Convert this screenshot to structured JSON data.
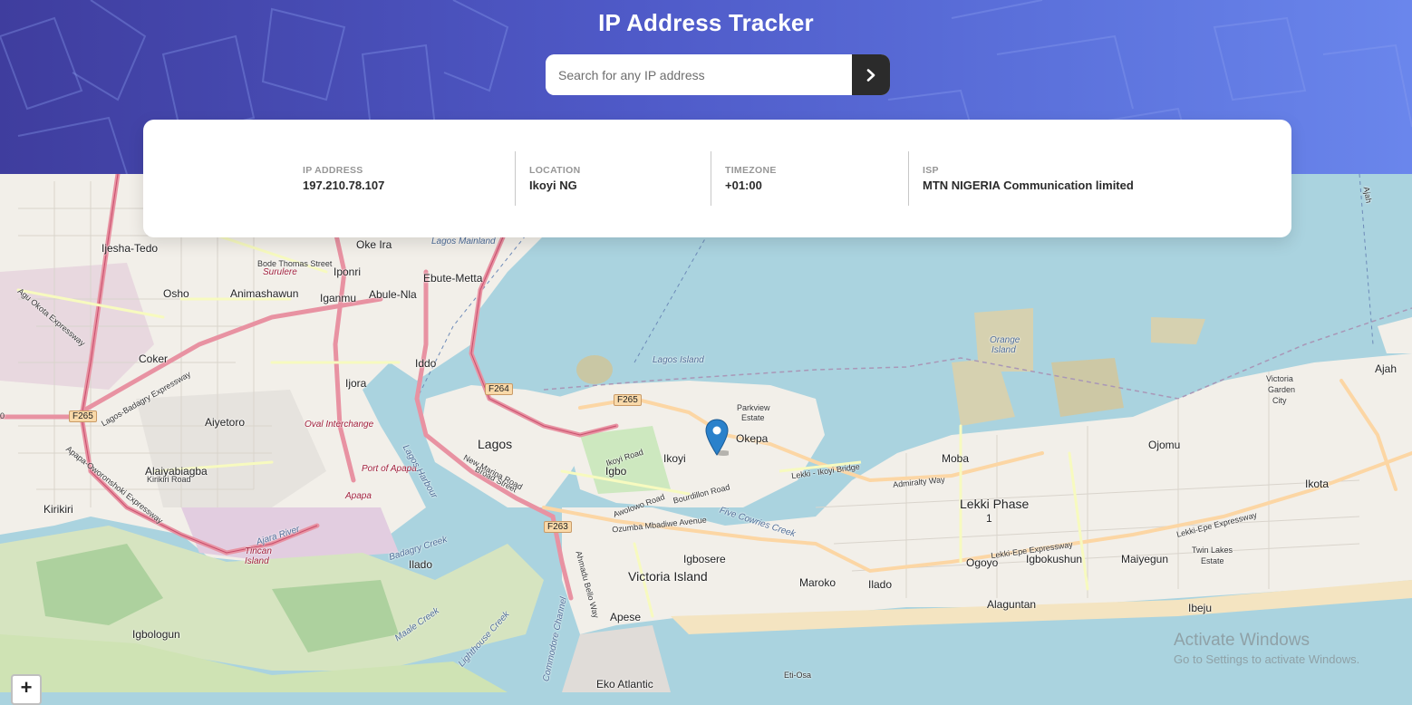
{
  "header": {
    "title": "IP Address Tracker",
    "gradient": [
      "#3f3d9e",
      "#6a86ec"
    ]
  },
  "search": {
    "placeholder": "Search for any IP address",
    "submit_icon": "chevron-right-icon"
  },
  "info": {
    "ip": {
      "label": "IP Address",
      "value": "197.210.78.107"
    },
    "location": {
      "label": "Location",
      "value": "Ikoyi NG"
    },
    "timezone": {
      "label": "Timezone",
      "value": "+01:00"
    },
    "isp": {
      "label": "ISP",
      "value": "MTN NIGERIA Communication limited"
    }
  },
  "map": {
    "marker_icon": "location-pin-icon",
    "zoom_in": "+",
    "colors": {
      "water": "#aad3df",
      "land": "#f2efe9",
      "marker": "#2a81cb"
    },
    "labels": {
      "ijesha_tedo": "Ijesha-Tedo",
      "oke_ira": "Oke Ira",
      "lagos_mainland": "Lagos Mainland",
      "bode_thomas": "Bode Thomas Street",
      "surulere": "Surulere",
      "iponri": "Iponri",
      "ebute_metta": "Ebute-Metta",
      "osho": "Osho",
      "animashawun": "Animashawun",
      "iganmu": "Iganmu",
      "abule_nla": "Abule-Nla",
      "agu_okota": "Agu Okota Expressway",
      "coker": "Coker",
      "iddo": "Iddo",
      "ijora": "Ijora",
      "f264": "F264",
      "f265": "F265",
      "f265_west": "F265",
      "f263": "F263",
      "aiyetoro": "Aiyetoro",
      "oval_interchange": "Oval Interchange",
      "lagos": "Lagos",
      "lagos_island": "Lagos Island",
      "parkview": "Parkview",
      "estate": "Estate",
      "okepa": "Okepa",
      "ikoyi": "Ikoyi",
      "igbo": "Igbo",
      "alaiyabiagba": "Alaiyabiagba",
      "kirikiri_road": "Kirikiri Road",
      "port_of_apapa": "Port of Apapa",
      "apapa": "Apapa",
      "kirikiri": "Kirikiri",
      "tincan": "Tincan",
      "island": "Island",
      "badagry_creek": "Badagry Creek",
      "ilado": "Ilado",
      "igbosere": "Igbosere",
      "victoria_island": "Victoria Island",
      "maroko": "Maroko",
      "ilado_east": "Ilado",
      "lekki_phase": "Lekki Phase",
      "one": "1",
      "moba": "Moba",
      "ogoyo": "Ogoyo",
      "igbokushun": "Igbokushun",
      "maiyegun": "Maiyegun",
      "alaguntan": "Alaguntan",
      "ibeju": "Ibeju",
      "ojomu": "Ojomu",
      "ikota": "Ikota",
      "ajah": "Ajah",
      "victoria_garden_city": "Victoria",
      "vgc2": "Garden",
      "vgc3": "City",
      "orange": "Orange",
      "orange_island": "Island",
      "twin_lakes": "Twin Lakes",
      "estate2": "Estate",
      "igbologun": "Igbologun",
      "apese": "Apese",
      "eko_atlantic": "Eko Atlantic",
      "eti_osa": "Eti-Osa",
      "five_cowries": "Five Cowries Creek",
      "ozumba": "Ozumba Mbadiwe Avenue",
      "lekki_epe": "Lekki-Epe Expressway",
      "admiralty": "Admiralty Way",
      "lekki_ikoyi_bridge": "Lekki - Ikoyi Bridge",
      "bourdillon": "Bourdillon Road",
      "awolowo": "Awolowo Road",
      "broad_street": "Broad Street",
      "new_marina": "New Marina Road",
      "lagos_harbour": "Lagos Harbour",
      "commodore": "Commodore Channel",
      "lighthouse": "Lighthouse Creek",
      "maale_creek": "Maale Creek",
      "ajara": "Ajara River",
      "oworonshoki": "Apapa-Oworonshoki Expressway",
      "ahmadu_bello": "Ahmadu Bello Way",
      "ikoyi_road": "Ikoyi Road",
      "lagos_badagry": "Lagos-Badagry Expressway",
      "ajah_road": "Ajah",
      "zero": "0"
    }
  },
  "watermark": {
    "line1": "Activate Windows",
    "line2": "Go to Settings to activate Windows."
  }
}
